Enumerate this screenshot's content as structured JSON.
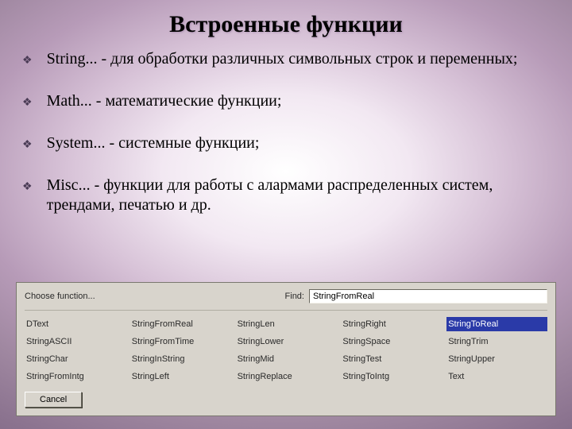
{
  "title": "Встроенные функции",
  "bullets": [
    "String... - для обработки различных символьных строк и переменных;",
    "Math... - математические функции;",
    "System... - системные функции;",
    "Misc... - функции для работы с алармами распределенных систем, трендами, печатью и др."
  ],
  "dialog": {
    "choose_label": "Choose function...",
    "find_label": "Find:",
    "find_value": "StringFromReal",
    "selected_index": 4,
    "functions": [
      "DText",
      "StringFromReal",
      "StringLen",
      "StringRight",
      "StringToReal",
      "StringASCII",
      "StringFromTime",
      "StringLower",
      "StringSpace",
      "StringTrim",
      "StringChar",
      "StringInString",
      "StringMid",
      "StringTest",
      "StringUpper",
      "StringFromIntg",
      "StringLeft",
      "StringReplace",
      "StringToIntg",
      "Text"
    ],
    "cancel_label": "Cancel"
  }
}
